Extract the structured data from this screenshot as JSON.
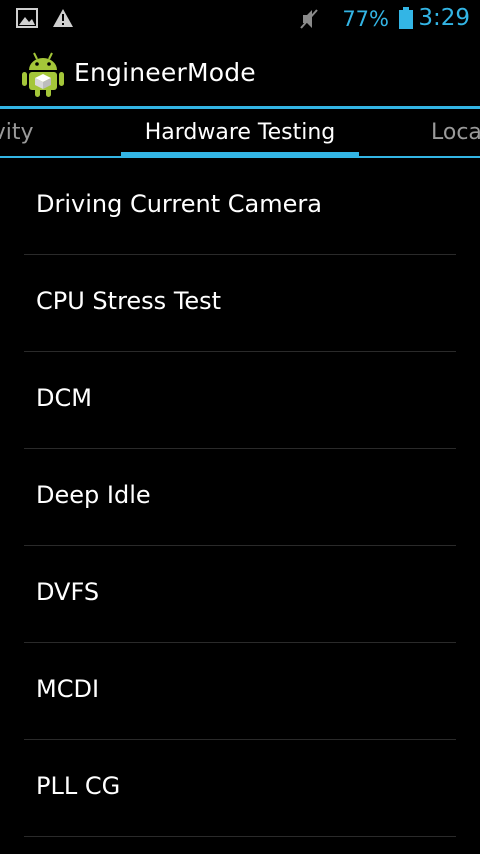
{
  "status_bar": {
    "left_icons": [
      "image-icon",
      "warning-icon"
    ],
    "right_icons": [
      "mute-icon",
      "battery-icon"
    ],
    "battery_percent": "77%",
    "time": "3:29",
    "accent_color": "#33b5e5"
  },
  "action_bar": {
    "app_icon": "android-icon",
    "title": "EngineerMode"
  },
  "tabs": {
    "previous": "tivity",
    "current": "Hardware Testing",
    "next": "Loca"
  },
  "list": {
    "items": [
      {
        "label": "Driving Current Camera"
      },
      {
        "label": "CPU Stress Test"
      },
      {
        "label": "DCM"
      },
      {
        "label": "Deep Idle"
      },
      {
        "label": "DVFS"
      },
      {
        "label": "MCDI"
      },
      {
        "label": "PLL CG"
      }
    ]
  }
}
